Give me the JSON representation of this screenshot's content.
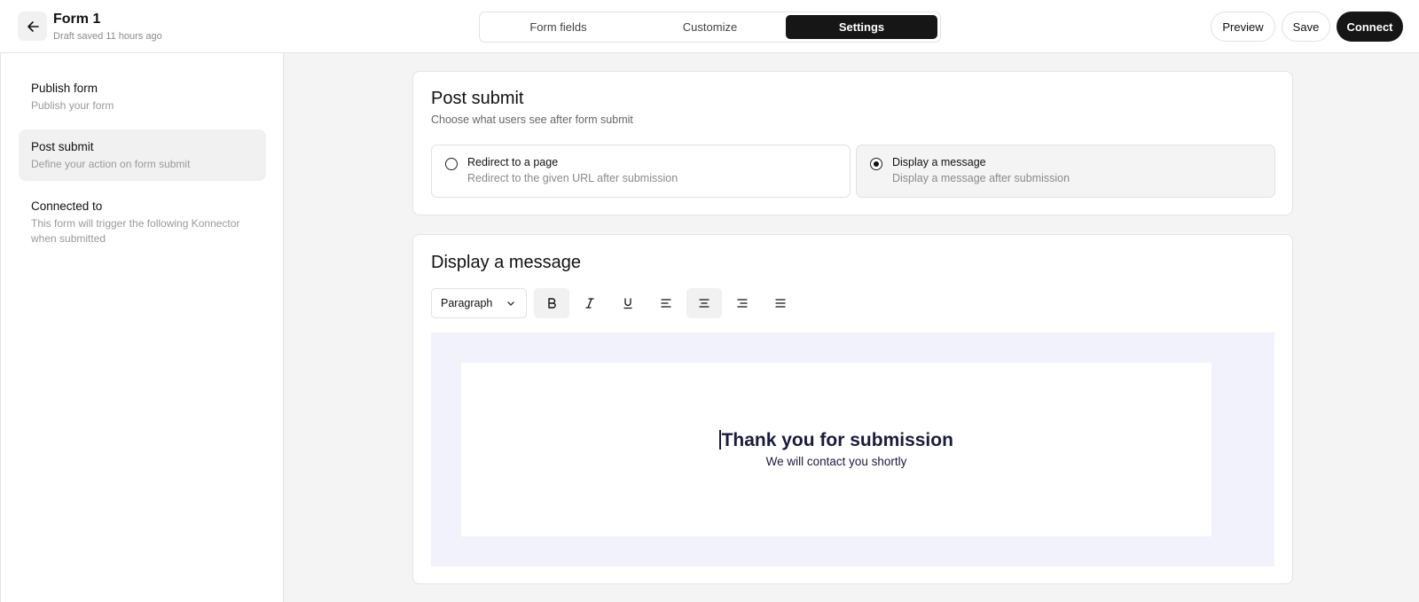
{
  "header": {
    "title": "Form 1",
    "status": "Draft saved 11 hours ago",
    "tabs": [
      {
        "label": "Form fields",
        "active": false
      },
      {
        "label": "Customize",
        "active": false
      },
      {
        "label": "Settings",
        "active": true
      }
    ],
    "buttons": {
      "preview": "Preview",
      "save": "Save",
      "connect": "Connect"
    }
  },
  "sidebar": {
    "items": [
      {
        "label": "Publish form",
        "desc": "Publish your form",
        "active": false
      },
      {
        "label": "Post submit",
        "desc": "Define your action on form submit",
        "active": true
      },
      {
        "label": "Connected to",
        "desc": "This form will trigger the following Konnector when submitted",
        "active": false
      }
    ]
  },
  "post_submit": {
    "title": "Post submit",
    "subtitle": "Choose what users see after form submit",
    "options": [
      {
        "label": "Redirect to a page",
        "desc": "Redirect to the given URL after submission",
        "selected": false
      },
      {
        "label": "Display a message",
        "desc": "Display a message after submission",
        "selected": true
      }
    ]
  },
  "display_message": {
    "title": "Display a message",
    "toolbar": {
      "block_type": "Paragraph",
      "icons": [
        "bold-icon",
        "italic-icon",
        "underline-icon",
        "align-left-icon",
        "align-center-icon",
        "align-right-icon",
        "align-justify-icon"
      ],
      "active": [
        "bold-icon",
        "align-center-icon"
      ]
    },
    "editor": {
      "heading": "Thank you for submission",
      "subtext": "We will contact you shortly"
    }
  },
  "colors": {
    "accent_dark": "#161616",
    "editor_bg": "#f1f2fc",
    "message_text": "#1b1b3f"
  }
}
